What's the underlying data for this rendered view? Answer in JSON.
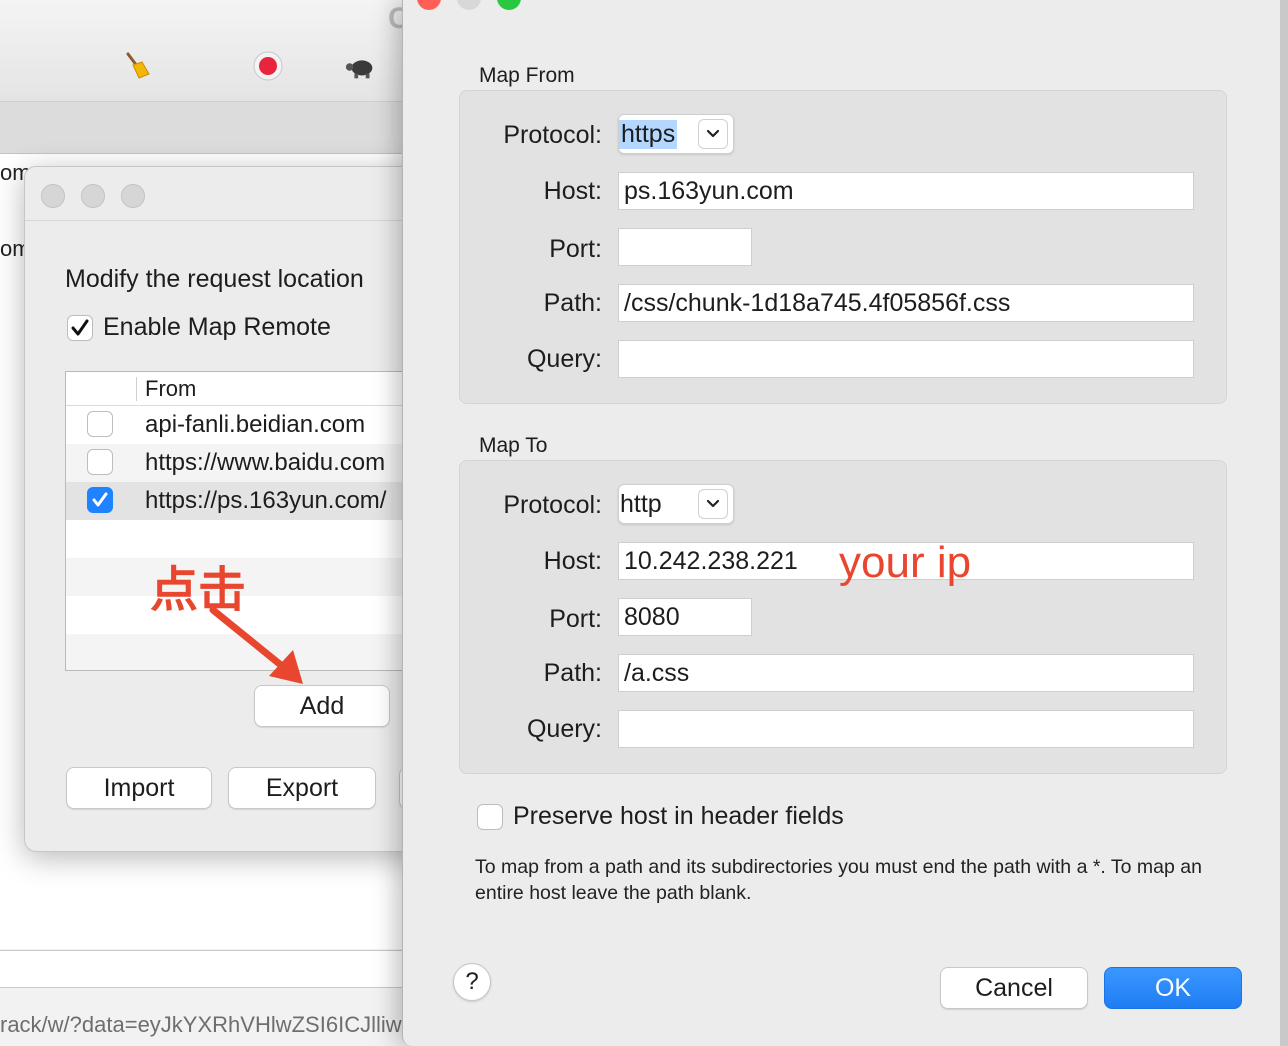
{
  "background_window": {
    "title_fragment": "C",
    "toolbar_icons": [
      "broom-icon",
      "record-icon",
      "turtle-icon"
    ],
    "left_fragments": [
      "om",
      "om"
    ],
    "status_url": "rack/w/?data=eyJkYXRhVHlwZSI6ICJlliw"
  },
  "settings": {
    "heading": "Modify the request location",
    "enable_label": "Enable Map Remote",
    "enable_checked": true,
    "column_from": "From",
    "rows": [
      {
        "from": "api-fanli.beidian.com",
        "checked": false
      },
      {
        "from": "https://www.baidu.com",
        "checked": false
      },
      {
        "from": "https://ps.163yun.com/",
        "checked": true
      }
    ],
    "add_label": "Add",
    "import_label": "Import",
    "export_label": "Export",
    "annotation_click": "点击"
  },
  "sheet": {
    "map_from": {
      "label": "Map From",
      "protocol_label": "Protocol:",
      "protocol": "https",
      "host_label": "Host:",
      "host": "ps.163yun.com",
      "port_label": "Port:",
      "port": "",
      "path_label": "Path:",
      "path": "/css/chunk-1d18a745.4f05856f.css",
      "query_label": "Query:",
      "query": ""
    },
    "map_to": {
      "label": "Map To",
      "protocol_label": "Protocol:",
      "protocol": "http",
      "host_label": "Host:",
      "host": "10.242.238.221",
      "port_label": "Port:",
      "port": "8080",
      "path_label": "Path:",
      "path": "/a.css",
      "query_label": "Query:",
      "query": ""
    },
    "annotation_your_ip": "your ip",
    "preserve_label": "Preserve host in header fields",
    "preserve_checked": false,
    "note": "To map from a path and its subdirectories you must end the path with a *. To map an entire host leave the path blank.",
    "help_label": "?",
    "cancel_label": "Cancel",
    "ok_label": "OK"
  },
  "colors": {
    "accent_blue": "#1f7df3",
    "annotation_red": "#e8462f",
    "selection_highlight": "#b3d7ff"
  }
}
